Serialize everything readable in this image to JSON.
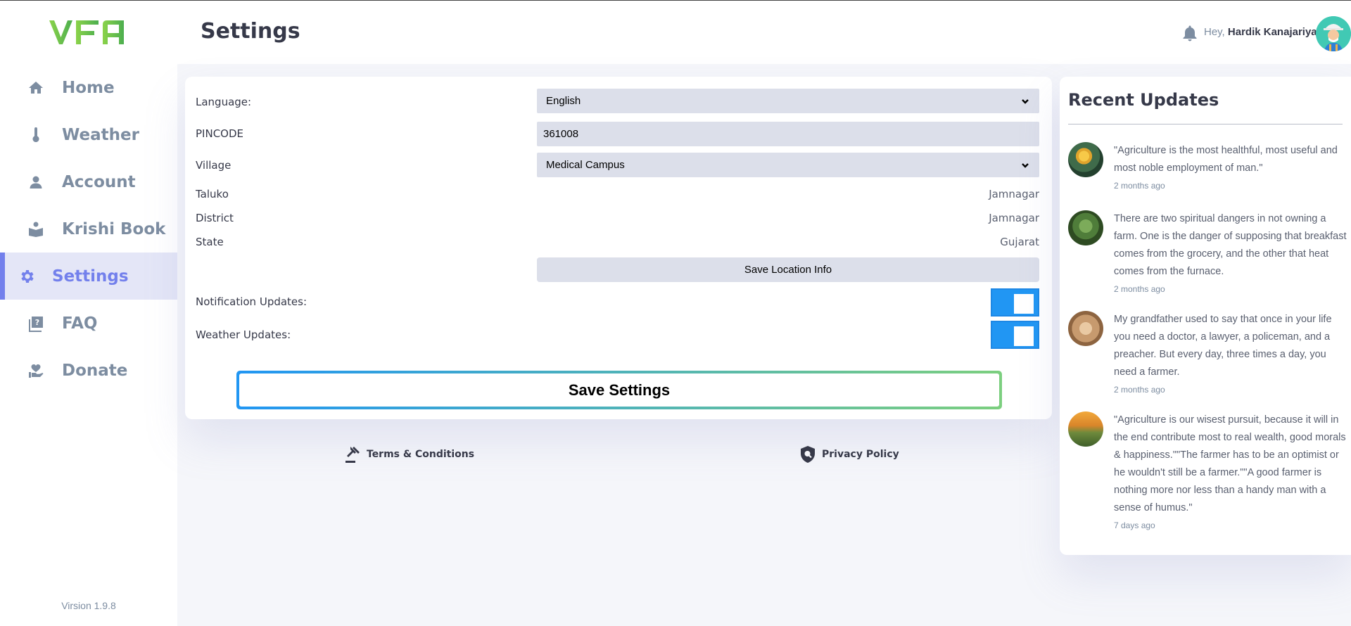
{
  "app": {
    "logo_text": "VFA",
    "version": "Virsion 1.9.8"
  },
  "sidebar": {
    "items": [
      {
        "label": "Home",
        "icon": "home-icon"
      },
      {
        "label": "Weather",
        "icon": "thermometer-icon"
      },
      {
        "label": "Account",
        "icon": "user-icon"
      },
      {
        "label": "Krishi Book",
        "icon": "book-reader-icon"
      },
      {
        "label": "Settings",
        "icon": "gear-icon",
        "active": true
      },
      {
        "label": "FAQ",
        "icon": "question-book-icon"
      },
      {
        "label": "Donate",
        "icon": "donate-heart-icon"
      }
    ]
  },
  "header": {
    "title": "Settings",
    "greeting_prefix": "Hey,",
    "user_name": "Hardik Kanajariya"
  },
  "settings": {
    "language_label": "Language:",
    "language_value": "English",
    "pincode_label": "PINCODE",
    "pincode_value": "361008",
    "village_label": "Village",
    "village_value": "Medical Campus",
    "taluko_label": "Taluko",
    "taluko_value": "Jamnagar",
    "district_label": "District",
    "district_value": "Jamnagar",
    "state_label": "State",
    "state_value": "Gujarat",
    "save_location_label": "Save Location Info",
    "notification_label": "Notification Updates:",
    "weather_label": "Weather Updates:",
    "save_settings_label": "Save Settings"
  },
  "footer": {
    "terms_label": "Terms & Conditions",
    "privacy_label": "Privacy Policy"
  },
  "updates": {
    "title": "Recent Updates",
    "items": [
      {
        "text": "\"Agriculture is the most healthful, most useful and most noble employment of man.\"",
        "ago": "2 months ago"
      },
      {
        "text": "There are two spiritual dangers in not owning a farm. One is the danger of supposing that breakfast comes from the grocery, and the other that heat comes from the furnace.",
        "ago": "2 months ago"
      },
      {
        "text": "My grandfather used to say that once in your life you need a doctor, a lawyer, a policeman, and a preacher. But every day, three times a day, you need a farmer.",
        "ago": "2 months ago"
      },
      {
        "text": "\"Agriculture is our wisest pursuit, because it will in the end contribute most to real wealth, good morals & happiness.\"\"The farmer has to be an optimist or he wouldn't still be a farmer.\"\"A good farmer is nothing more nor less than a handy man with a sense of humus.\"",
        "ago": "7 days ago"
      }
    ]
  },
  "colors": {
    "accent": "#7380ec",
    "toggle_on": "#2196f3",
    "logo_green": "#6cc04a",
    "page_bg": "#f5f6fa"
  }
}
